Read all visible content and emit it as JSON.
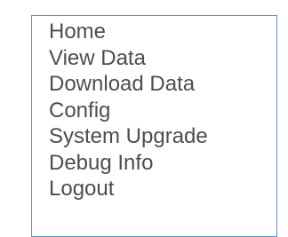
{
  "menu": {
    "items": [
      {
        "label": "Home"
      },
      {
        "label": "View Data"
      },
      {
        "label": "Download Data"
      },
      {
        "label": "Config"
      },
      {
        "label": "System Upgrade"
      },
      {
        "label": "Debug Info"
      },
      {
        "label": "Logout"
      }
    ],
    "border_color": "#5b8fd0",
    "text_color": "#4d4d4d"
  }
}
